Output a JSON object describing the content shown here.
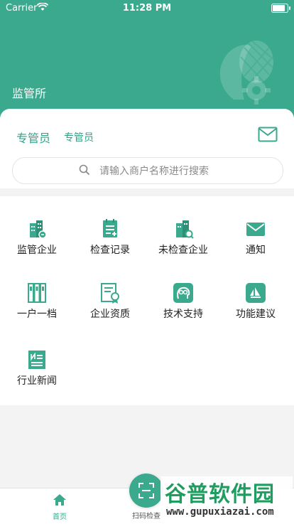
{
  "status_bar": {
    "carrier": "Carrier",
    "time": "11:28 PM"
  },
  "header": {
    "title": "监管所"
  },
  "user": {
    "role": "专管员",
    "name": "专管员"
  },
  "search": {
    "placeholder": "请输入商户名称进行搜索"
  },
  "menu": [
    {
      "label": "监管企业",
      "icon": "building-link-icon"
    },
    {
      "label": "检查记录",
      "icon": "clipboard-add-icon"
    },
    {
      "label": "未检查企业",
      "icon": "building-search-icon"
    },
    {
      "label": "通知",
      "icon": "envelope-icon"
    },
    {
      "label": "一户一档",
      "icon": "binders-icon"
    },
    {
      "label": "企业资质",
      "icon": "certificate-icon"
    },
    {
      "label": "技术支持",
      "icon": "support-head-icon"
    },
    {
      "label": "功能建议",
      "icon": "suggestion-icon"
    },
    {
      "label": "行业新闻",
      "icon": "news-icon"
    }
  ],
  "tabbar": {
    "home": "首页",
    "scan": "扫码检查"
  },
  "watermark": {
    "brand": "谷普软件园",
    "url": "www.gupuxiazai.com"
  },
  "colors": {
    "accent": "#3aa98e",
    "background": "#f3f3f4"
  }
}
